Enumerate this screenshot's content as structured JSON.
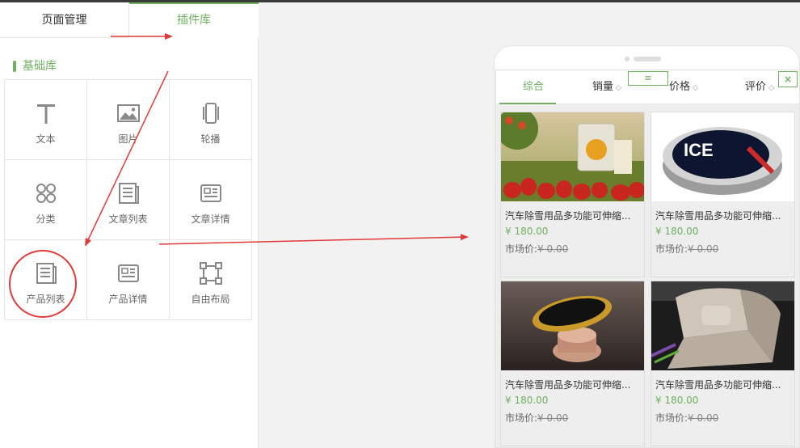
{
  "tabs": {
    "page_manage": "页面管理",
    "plugin_library": "插件库"
  },
  "section": {
    "title": "基础库"
  },
  "widgets": [
    {
      "label": "文本",
      "icon": "text-icon"
    },
    {
      "label": "图片",
      "icon": "image-icon"
    },
    {
      "label": "轮播",
      "icon": "carousel-icon"
    },
    {
      "label": "分类",
      "icon": "category-icon"
    },
    {
      "label": "文章列表",
      "icon": "article-list-icon"
    },
    {
      "label": "文章详情",
      "icon": "article-detail-icon"
    },
    {
      "label": "产品列表",
      "icon": "product-list-icon"
    },
    {
      "label": "产品详情",
      "icon": "product-detail-icon"
    },
    {
      "label": "自由布局",
      "icon": "free-layout-icon"
    }
  ],
  "preview": {
    "sort": {
      "comprehensive": "综合",
      "sales": "销量",
      "price": "价格",
      "rating": "评价",
      "arrows": "◇"
    },
    "drag_handle": "≡",
    "close": "×",
    "products": [
      {
        "title": "汽车除雪用品多功能可伸缩...",
        "price": "¥ 180.00",
        "market_label": "市场价:",
        "market_price": "¥ 0.00",
        "image": "air-freshener-strawberry"
      },
      {
        "title": "汽车除雪用品多功能可伸缩...",
        "price": "¥ 180.00",
        "market_label": "市场价:",
        "market_price": "¥ 0.00",
        "image": "ice-wax-tin"
      },
      {
        "title": "汽车除雪用品多功能可伸缩...",
        "price": "¥ 180.00",
        "market_label": "市场价:",
        "market_price": "¥ 0.00",
        "image": "magnetic-phone-mount"
      },
      {
        "title": "汽车除雪用品多功能可伸缩...",
        "price": "¥ 180.00",
        "market_label": "市场价:",
        "market_price": "¥ 0.00",
        "image": "car-seat-interior"
      }
    ]
  },
  "colors": {
    "accent": "#6fb061",
    "annotation_red": "#e23a3a"
  }
}
